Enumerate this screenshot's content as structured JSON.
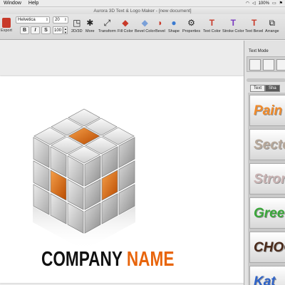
{
  "menubar": {
    "items": [
      "Window",
      "Help"
    ],
    "battery": "100%"
  },
  "window": {
    "title": "Aurora 3D Text & Logo Maker - [new document]"
  },
  "toolbar": {
    "export_label": "Export",
    "font_family": "Helvetica",
    "font_size": "20",
    "bold": "B",
    "italic": "I",
    "strike": "S",
    "number_value": "100",
    "tools": [
      {
        "label": "2D/3D",
        "icon": "2d-3d-icon"
      },
      {
        "label": "More",
        "icon": "more-icon"
      },
      {
        "label": "Transform",
        "icon": "transform-icon"
      },
      {
        "label": "Fill Color",
        "icon": "fill-color-icon"
      },
      {
        "label": "Bevel Color",
        "icon": "bevel-color-icon"
      },
      {
        "label": "Bevel",
        "icon": "bevel-icon"
      },
      {
        "label": "Shape",
        "icon": "shape-icon"
      },
      {
        "label": "Properties",
        "icon": "properties-icon"
      },
      {
        "label": "Text Color",
        "icon": "text-color-icon"
      },
      {
        "label": "Stroke Color",
        "icon": "stroke-color-icon"
      },
      {
        "label": "Text Bevel",
        "icon": "text-bevel-icon"
      },
      {
        "label": "Arrange",
        "icon": "arrange-icon"
      }
    ]
  },
  "canvas": {
    "logo_word1": "COMPANY",
    "logo_word2": "NAME",
    "colors": {
      "accent": "#e8650c",
      "dark": "#111111"
    }
  },
  "right_panel": {
    "text_mode_label": "Text Mode",
    "tabs": [
      "Text",
      "Sha"
    ],
    "styles": [
      {
        "text": "Pain",
        "color": "#f08a2a"
      },
      {
        "text": "Secto",
        "color": "#b7a89a"
      },
      {
        "text": "Stron",
        "color": "#c9b3b3"
      },
      {
        "text": "Gree",
        "color": "#3aa63a"
      },
      {
        "text": "CHOC",
        "color": "#4a2a1a"
      },
      {
        "text": "Kat",
        "color": "#2f63c8"
      }
    ]
  }
}
